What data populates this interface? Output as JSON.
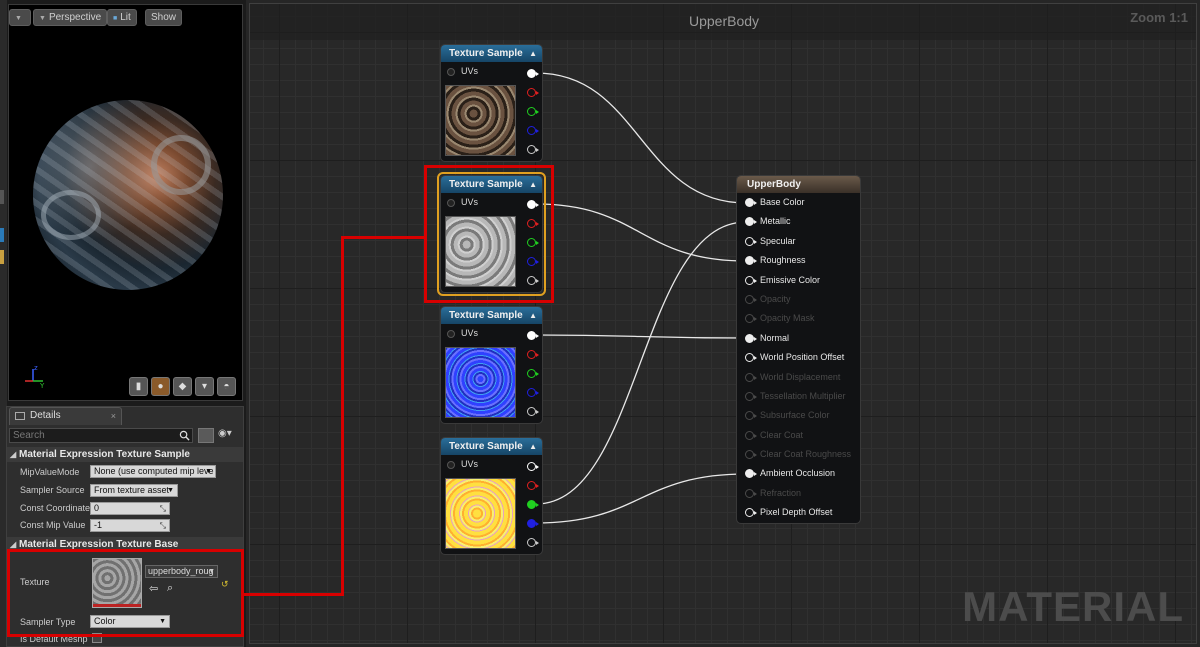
{
  "viewport": {
    "perspective_label": "Perspective",
    "lit_label": "Lit",
    "show_label": "Show",
    "axis_z": "z",
    "axis_y": "Y"
  },
  "details": {
    "tab_label": "Details",
    "search_placeholder": "Search",
    "section1_title": "Material Expression Texture Sample",
    "props1": [
      {
        "label": "MipValueMode",
        "value": "None (use computed mip leve"
      },
      {
        "label": "Sampler Source",
        "value": "From texture asset"
      },
      {
        "label": "Const Coordinate",
        "value": "0"
      },
      {
        "label": "Const Mip Value",
        "value": "-1"
      }
    ],
    "section2_title": "Material Expression Texture Base",
    "texture_label": "Texture",
    "texture_value": "upperbody_roug",
    "sampler_type_label": "Sampler Type",
    "sampler_type_value": "Color",
    "is_default_meshpaint_label": "Is Default Meshp"
  },
  "graph": {
    "title": "UpperBody",
    "zoom": "Zoom 1:1",
    "watermark": "MATERIAL"
  },
  "texture_nodes": [
    {
      "title": "Texture Sample",
      "uvs_label": "UVs"
    },
    {
      "title": "Texture Sample",
      "uvs_label": "UVs"
    },
    {
      "title": "Texture Sample",
      "uvs_label": "UVs"
    },
    {
      "title": "Texture Sample",
      "uvs_label": "UVs"
    }
  ],
  "material_node": {
    "title": "UpperBody",
    "pins": [
      {
        "label": "Base Color",
        "enabled": true,
        "connected": true
      },
      {
        "label": "Metallic",
        "enabled": true,
        "connected": true
      },
      {
        "label": "Specular",
        "enabled": true,
        "connected": false
      },
      {
        "label": "Roughness",
        "enabled": true,
        "connected": true
      },
      {
        "label": "Emissive Color",
        "enabled": true,
        "connected": false
      },
      {
        "label": "Opacity",
        "enabled": false,
        "connected": false
      },
      {
        "label": "Opacity Mask",
        "enabled": false,
        "connected": false
      },
      {
        "label": "Normal",
        "enabled": true,
        "connected": true
      },
      {
        "label": "World Position Offset",
        "enabled": true,
        "connected": false
      },
      {
        "label": "World Displacement",
        "enabled": false,
        "connected": false
      },
      {
        "label": "Tessellation Multiplier",
        "enabled": false,
        "connected": false
      },
      {
        "label": "Subsurface Color",
        "enabled": false,
        "connected": false
      },
      {
        "label": "Clear Coat",
        "enabled": false,
        "connected": false
      },
      {
        "label": "Clear Coat Roughness",
        "enabled": false,
        "connected": false
      },
      {
        "label": "Ambient Occlusion",
        "enabled": true,
        "connected": true
      },
      {
        "label": "Refraction",
        "enabled": false,
        "connected": false
      },
      {
        "label": "Pixel Depth Offset",
        "enabled": true,
        "connected": false
      }
    ]
  },
  "colors": {
    "highlight_red": "#d80000",
    "selected_orange": "#e0a020",
    "node_header_blue": "#2a6e9a"
  }
}
